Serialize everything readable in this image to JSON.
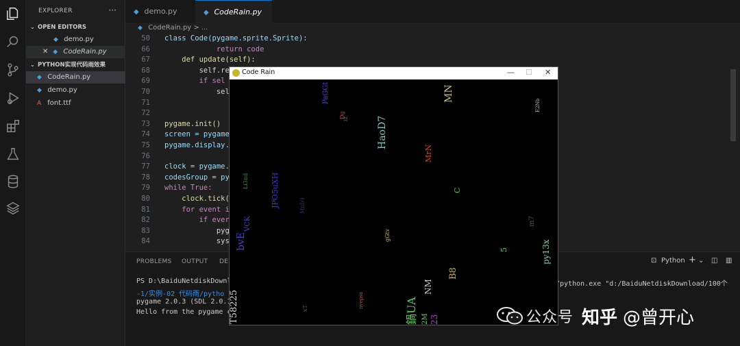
{
  "sidebar": {
    "title": "EXPLORER",
    "more": "···",
    "open_editors_label": "OPEN EDITORS",
    "open_editors": [
      {
        "name": "demo.py"
      },
      {
        "name": "CodeRain.py"
      }
    ],
    "folder_label": "PYTHON实现代码雨效果",
    "files": [
      {
        "name": "CodeRain.py"
      },
      {
        "name": "demo.py"
      },
      {
        "name": "font.ttf"
      }
    ]
  },
  "tabs": [
    {
      "label": "demo.py"
    },
    {
      "label": "CodeRain.py",
      "close": "✕"
    }
  ],
  "breadcrumb": "CodeRain.py > ...",
  "code": [
    {
      "n": "50",
      "t": "class Code(pygame.sprite.Sprite):"
    },
    {
      "n": "66",
      "t": "            return code"
    },
    {
      "n": "67",
      "t": "    def update(self):"
    },
    {
      "n": "68",
      "t": "        self.re"
    },
    {
      "n": "69",
      "t": "        if sel"
    },
    {
      "n": "70",
      "t": "            sel"
    },
    {
      "n": "71",
      "t": ""
    },
    {
      "n": "72",
      "t": ""
    },
    {
      "n": "73",
      "t": "pygame.init()"
    },
    {
      "n": "74",
      "t": "screen = pygame"
    },
    {
      "n": "75",
      "t": "pygame.display."
    },
    {
      "n": "76",
      "t": ""
    },
    {
      "n": "77",
      "t": "clock = pygame."
    },
    {
      "n": "78",
      "t": "codesGroup = py"
    },
    {
      "n": "79",
      "t": "while True:"
    },
    {
      "n": "80",
      "t": "    clock.tick("
    },
    {
      "n": "81",
      "t": "    for event i"
    },
    {
      "n": "82",
      "t": "        if ever"
    },
    {
      "n": "83",
      "t": "            pyg"
    },
    {
      "n": "84",
      "t": "            sys"
    }
  ],
  "panel": {
    "tabs": [
      "PROBLEMS",
      "OUTPUT",
      "DEB"
    ],
    "python_label": "Python",
    "plus": "+",
    "terminal": [
      {
        "text": "PS D:\\BaiduNetdiskDownl",
        "right": "a3/python.exe \"d:/BaiduNetdiskDownload/100个"
      },
      {
        "text": "-1/实例-02 代码雨/pytho"
      },
      {
        "text": "pygame 2.0.3 (SDL 2.0.1"
      },
      {
        "text": "Hello from the pygame c"
      }
    ]
  },
  "pygame_window": {
    "title": "Code Rain",
    "minimize": "—",
    "maximize": "☐",
    "close": "✕"
  },
  "rain": [
    {
      "t": "PaGGt",
      "c": "#5b3fd6"
    },
    {
      "t": "Dg",
      "c": "#b04a4a"
    },
    {
      "t": "3Z",
      "c": "#777777"
    },
    {
      "t": "MN",
      "c": "#d0c080"
    },
    {
      "t": "HaoD7",
      "c": "#7fd0c0"
    },
    {
      "t": "E2Nb",
      "c": "#bbbbbb"
    },
    {
      "t": "MrN",
      "c": "#d04a2a"
    },
    {
      "t": "C",
      "c": "#5bd05b"
    },
    {
      "t": "Li3nd",
      "c": "#3a8a5a"
    },
    {
      "t": "JPO5uXH",
      "c": "#3a3ad0"
    },
    {
      "t": "bvE",
      "c": "#5a3ad6"
    },
    {
      "t": "VCK",
      "c": "#4a4ad0"
    },
    {
      "t": "gGtv",
      "c": "#c0c040"
    },
    {
      "t": "m7",
      "c": "#555555"
    },
    {
      "t": "py13x",
      "c": "#7fd0c0"
    },
    {
      "t": "5",
      "c": "#5bd05b"
    },
    {
      "t": "B8",
      "c": "#c0b060"
    },
    {
      "t": "NM",
      "c": "#cccccc"
    },
    {
      "t": "T58225",
      "c": "#dddddd"
    },
    {
      "t": "xT",
      "c": "#555555"
    },
    {
      "t": "鍋UA",
      "c": "#5bd05b"
    },
    {
      "t": "2M",
      "c": "#5bd05b"
    },
    {
      "t": "23",
      "c": "#b04ad0"
    },
    {
      "t": "nyepsa",
      "c": "#d04a4a"
    },
    {
      "t": "Mnb9",
      "c": "#333366"
    }
  ],
  "watermark": {
    "text": "公众号",
    "zhihu": "知乎",
    "user": "@曾开心"
  }
}
